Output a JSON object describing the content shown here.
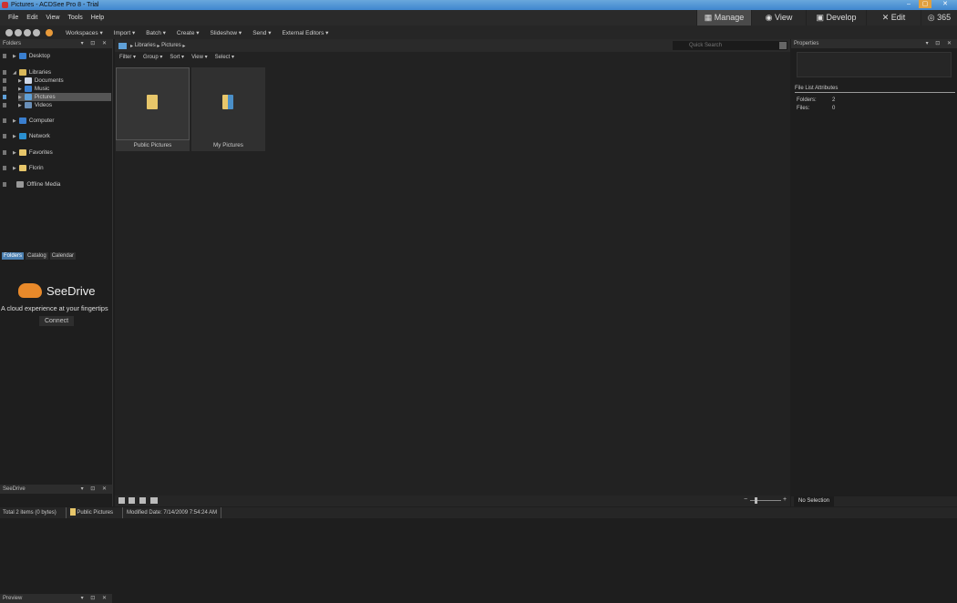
{
  "window": {
    "title": "Pictures - ACDSee Pro 8 - Trial",
    "controls": [
      "–",
      "▢",
      "✕"
    ]
  },
  "menu": [
    "File",
    "Edit",
    "View",
    "Tools",
    "Help"
  ],
  "modes": [
    {
      "label": "Manage",
      "icon": "grid-icon",
      "active": true
    },
    {
      "label": "View",
      "icon": "eye-icon"
    },
    {
      "label": "Develop",
      "icon": "image-icon"
    },
    {
      "label": "Edit",
      "icon": "tools-icon"
    },
    {
      "label": "365",
      "icon": "cloud-365-icon"
    }
  ],
  "toolbar": [
    "Workspaces ▾",
    "Import ▾",
    "Batch ▾",
    "Create ▾",
    "Slideshow ▾",
    "Send ▾",
    "External Editors ▾"
  ],
  "folders_panel": {
    "title": "Folders",
    "controls": "▾ ⊡ ✕",
    "items": [
      {
        "label": "Desktop",
        "color": "#3a7fd0"
      },
      {
        "label": "Libraries",
        "color": "#d9b85a"
      },
      {
        "label": "Documents",
        "color": "#cfd8e8"
      },
      {
        "label": "Music",
        "color": "#3a7fd0"
      },
      {
        "label": "Pictures",
        "color": "#5fa0d8"
      },
      {
        "label": "Videos",
        "color": "#6a8fb8"
      },
      {
        "label": "Computer",
        "color": "#3a7fd0"
      },
      {
        "label": "Network",
        "color": "#2a8fd0"
      },
      {
        "label": "Favorites",
        "color": "#e7c66a"
      },
      {
        "label": "Florin",
        "color": "#e7c66a"
      },
      {
        "label": "Offline Media",
        "color": "#999999"
      }
    ],
    "tabs": [
      "Folders",
      "Catalog",
      "Calendar"
    ]
  },
  "seedrive": {
    "title": "SeeDrive",
    "brand": "SeeDrive",
    "tagline": "A cloud experience at your fingertips",
    "button": "Connect"
  },
  "preview": {
    "title": "Preview"
  },
  "breadcrumb": [
    "Libraries",
    "Pictures"
  ],
  "search": {
    "placeholder": "Quick Search"
  },
  "filters": [
    "Filter ▾",
    "Group ▾",
    "Sort ▾",
    "View ▾",
    "Select ▾"
  ],
  "files": [
    {
      "name": "Public Pictures"
    },
    {
      "name": "My Pictures"
    }
  ],
  "properties": {
    "title": "Properties",
    "section": "File List Attributes",
    "folders_label": "Folders:",
    "folders_value": "2",
    "files_label": "Files:",
    "files_value": "0",
    "tab": "No Selection"
  },
  "status": {
    "total": "Total 2 items  (0 bytes)",
    "item": "Public Pictures",
    "modified": "Modified Date: 7/14/2009 7:54:24 AM"
  }
}
